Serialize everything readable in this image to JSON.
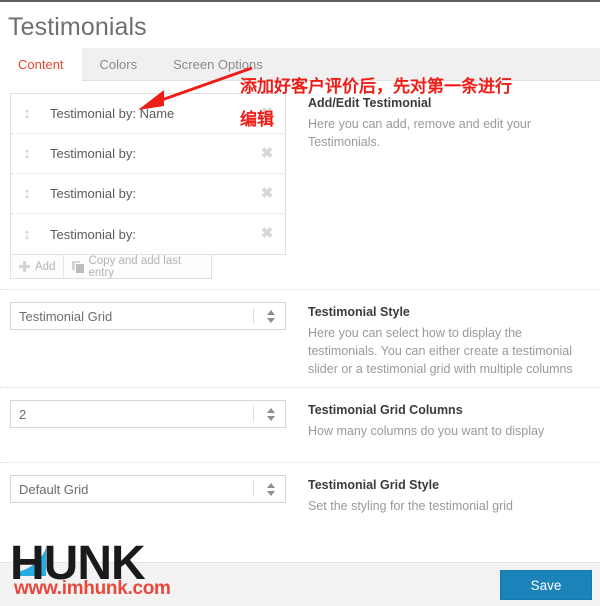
{
  "header": {
    "title": "Testimonials"
  },
  "tabs": [
    {
      "label": "Content",
      "active": true
    },
    {
      "label": "Colors",
      "active": false
    },
    {
      "label": "Screen Options",
      "active": false
    }
  ],
  "sections": {
    "testimonials": {
      "title": "Add/Edit Testimonial",
      "description": "Here you can add, remove and edit your Testimonials.",
      "rows": [
        {
          "label": "Testimonial by: Name"
        },
        {
          "label": "Testimonial by:"
        },
        {
          "label": "Testimonial by:"
        },
        {
          "label": "Testimonial by:"
        }
      ],
      "add_label": "Add",
      "copy_label": "Copy and add last entry"
    },
    "style": {
      "title": "Testimonial Style",
      "description": "Here you can select how to display the testimonials. You can either create a testimonial slider or a testimonial grid with multiple columns",
      "value": "Testimonial Grid"
    },
    "columns": {
      "title": "Testimonial Grid Columns",
      "description": "How many columns do you want to display",
      "value": "2"
    },
    "grid_style": {
      "title": "Testimonial Grid Style",
      "description": "Set the styling for the testimonial grid",
      "value": "Default Grid"
    }
  },
  "footer": {
    "save_label": "Save"
  },
  "watermark": {
    "brand": "HUNK",
    "url": "www.imhunk.com"
  },
  "annotations": {
    "line1": "添加好客户评价后，先对第一条进行",
    "line2": "编辑"
  },
  "colors": {
    "accent": "#e8472a",
    "save_button": "#1b83b8",
    "annotation": "#ef1d17",
    "watermark_url": "#e8483c",
    "watermark_swoosh": "#29abe2"
  }
}
